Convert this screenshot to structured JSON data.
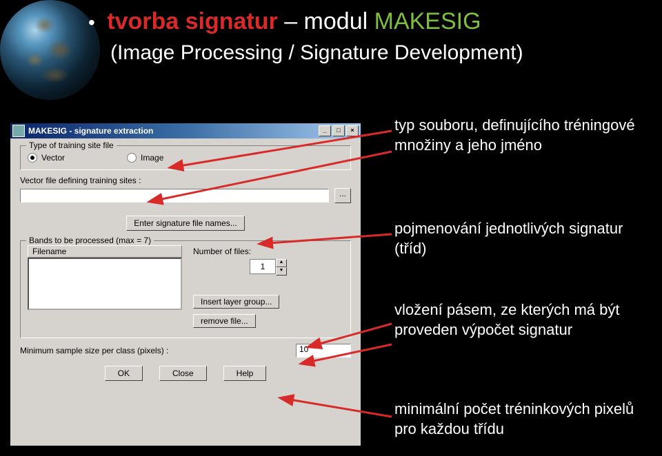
{
  "title": {
    "part1": "tvorba signatur",
    "part2": "– modul",
    "part3": "MAKESIG",
    "sub": "(Image Processing / Signature Development)"
  },
  "dialog": {
    "title": "MAKESIG - signature extraction",
    "group_legend": "Type of training site file",
    "radio_vector": "Vector",
    "radio_image": "Image",
    "label_vecfile": "Vector file defining training sites :",
    "label_enter_sig": "Enter signature file names...",
    "group_bands_legend": "Bands to be processed (max = 7)",
    "col_filename": "Filename",
    "label_numfiles": "Number of files:",
    "numfiles_value": "1",
    "btn_insert_layer": "Insert layer group...",
    "btn_remove_file": "remove file...",
    "label_minsample": "Minimum sample size per class (pixels) :",
    "minsample_value": "10",
    "btn_ok": "OK",
    "btn_close": "Close",
    "btn_help": "Help"
  },
  "anno": {
    "a1": "typ souboru, definujícího tréningové množiny a jeho jméno",
    "a2": "pojmenování jednotlivých signatur (tříd)",
    "a3": "vložení pásem, ze kterých má být proveden výpočet signatur",
    "a4": "minimální počet tréninkových pixelů pro každou třídu"
  }
}
